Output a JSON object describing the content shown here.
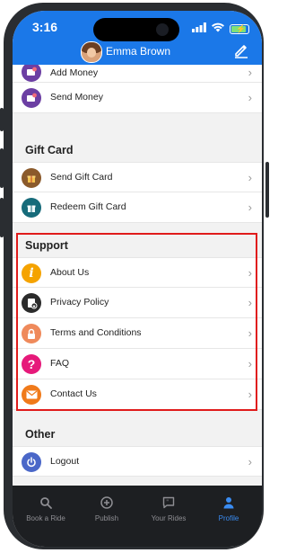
{
  "status_bar": {
    "time": "3:16"
  },
  "header": {
    "user_name": "Emma Brown"
  },
  "wallet": {
    "items": [
      {
        "label": "Add Money",
        "icon": "wallet-plus-icon",
        "color": "#6c3fa3"
      },
      {
        "label": "Send Money",
        "icon": "wallet-send-icon",
        "color": "#6c3fa3"
      }
    ]
  },
  "gift_card": {
    "title": "Gift Card",
    "items": [
      {
        "label": "Send Gift Card",
        "icon": "gift-send-icon",
        "color": "#8b5a2b"
      },
      {
        "label": "Redeem Gift Card",
        "icon": "gift-redeem-icon",
        "color": "#166b7a"
      }
    ]
  },
  "support": {
    "title": "Support",
    "items": [
      {
        "label": "About Us",
        "icon": "info-icon",
        "color": "#f5a300"
      },
      {
        "label": "Privacy Policy",
        "icon": "privacy-icon",
        "color": "#2b2b2b"
      },
      {
        "label": "Terms and Conditions",
        "icon": "lock-icon",
        "color": "#ef8a5b"
      },
      {
        "label": "FAQ",
        "icon": "question-icon",
        "color": "#e6197a"
      },
      {
        "label": "Contact Us",
        "icon": "mail-icon",
        "color": "#f07a1a"
      }
    ]
  },
  "other": {
    "title": "Other",
    "items": [
      {
        "label": "Logout",
        "icon": "power-icon",
        "color": "#4a67c8"
      }
    ]
  },
  "tabbar": {
    "tabs": [
      {
        "label": "Book a Ride",
        "icon": "search-icon"
      },
      {
        "label": "Publish",
        "icon": "plus-circle-icon"
      },
      {
        "label": "Your Rides",
        "icon": "chat-icon"
      },
      {
        "label": "Profile",
        "icon": "person-icon",
        "active": true
      }
    ]
  },
  "colors": {
    "header": "#1b78e8",
    "active_tab": "#3a8cf2",
    "highlight_border": "#e01b1b"
  }
}
